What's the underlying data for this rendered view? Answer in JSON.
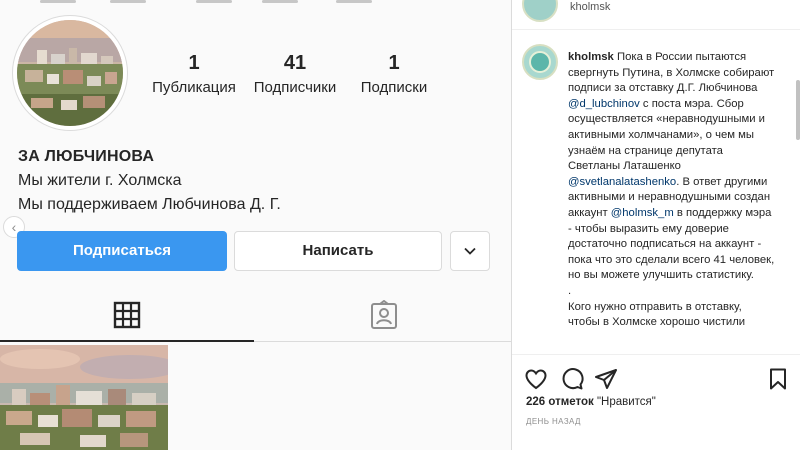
{
  "profile": {
    "stats": [
      {
        "value": "1",
        "label": "Публикация"
      },
      {
        "value": "41",
        "label": "Подписчики"
      },
      {
        "value": "1",
        "label": "Подписки"
      }
    ],
    "name": "ЗА ЛЮБЧИНОВА",
    "bio_lines": [
      "Мы жители г. Холмска",
      "Мы поддерживаем Любчинова Д. Г."
    ],
    "buttons": {
      "follow": "Подписаться",
      "message": "Написать"
    },
    "tabs": [
      {
        "icon": "grid-icon",
        "active": true
      },
      {
        "icon": "tagged-icon",
        "active": false
      }
    ]
  },
  "post": {
    "header_username": "kholmsk",
    "author": "kholmsk",
    "caption_parts": [
      {
        "t": "text",
        "v": " Пока в России пытаются свергнуть Путина, в Холмске собирают подписи за отставку Д.Г. Любчинова "
      },
      {
        "t": "mention",
        "v": "@d_lubchinov"
      },
      {
        "t": "text",
        "v": " с поста мэра. Сбор осуществляется «неравнодушными и активными холмчанами», о чем мы узнаём на странице депутата Светланы Латашенко "
      },
      {
        "t": "mention",
        "v": "@svetlanalatashenko"
      },
      {
        "t": "text",
        "v": ". В ответ другими активными и неравнодушными создан аккаунт "
      },
      {
        "t": "mention",
        "v": "@holmsk_m"
      },
      {
        "t": "text",
        "v": " в поддержку мэра - чтобы выразить ему доверие достаточно подписаться на аккаунт - пока что это сделали всего 41 человек, но вы можете улучшить статистику."
      }
    ],
    "caption_dot": ".",
    "caption_tail": "Кого нужно отправить в отставку, чтобы в Холмске хорошо чистили",
    "likes_count": "226 отметок",
    "likes_text": " \"Нравится\"",
    "date": "день назад"
  },
  "colors": {
    "accent": "#3a97f0",
    "mention": "#00376b",
    "border": "#dbdbdb"
  }
}
